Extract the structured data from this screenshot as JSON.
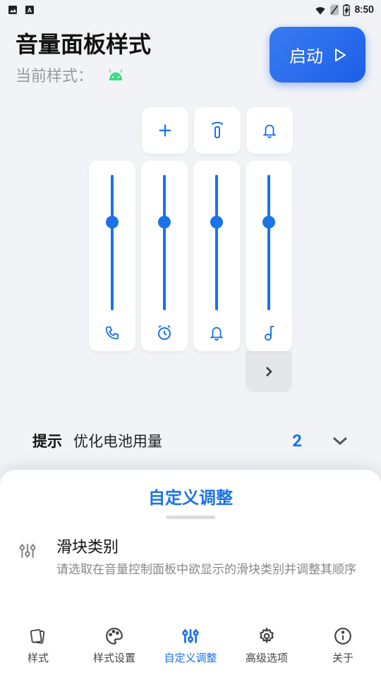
{
  "status": {
    "time": "8:50"
  },
  "header": {
    "title": "音量面板样式",
    "subtitle": "当前样式：",
    "start_label": "启动"
  },
  "preview": {
    "top_icons": [
      {
        "name": "add-icon"
      },
      {
        "name": "remote-icon"
      },
      {
        "name": "bell-icon"
      }
    ],
    "sliders": [
      {
        "icon": "phone-icon",
        "level": 0.33
      },
      {
        "icon": "alarm-icon",
        "level": 0.33
      },
      {
        "icon": "bell-icon",
        "level": 0.33
      },
      {
        "icon": "note-icon",
        "level": 0.33
      }
    ]
  },
  "tip": {
    "label": "提示",
    "text": "优化电池用量",
    "count": "2"
  },
  "sheet": {
    "title": "自定义调整",
    "setting": {
      "title": "滑块类别",
      "desc": "请选取在音量控制面板中欲显示的滑块类别并调整其顺序"
    }
  },
  "nav": [
    {
      "label": "样式",
      "active": false
    },
    {
      "label": "样式设置",
      "active": false
    },
    {
      "label": "自定义调整",
      "active": true
    },
    {
      "label": "高级选项",
      "active": false
    },
    {
      "label": "关于",
      "active": false
    }
  ]
}
